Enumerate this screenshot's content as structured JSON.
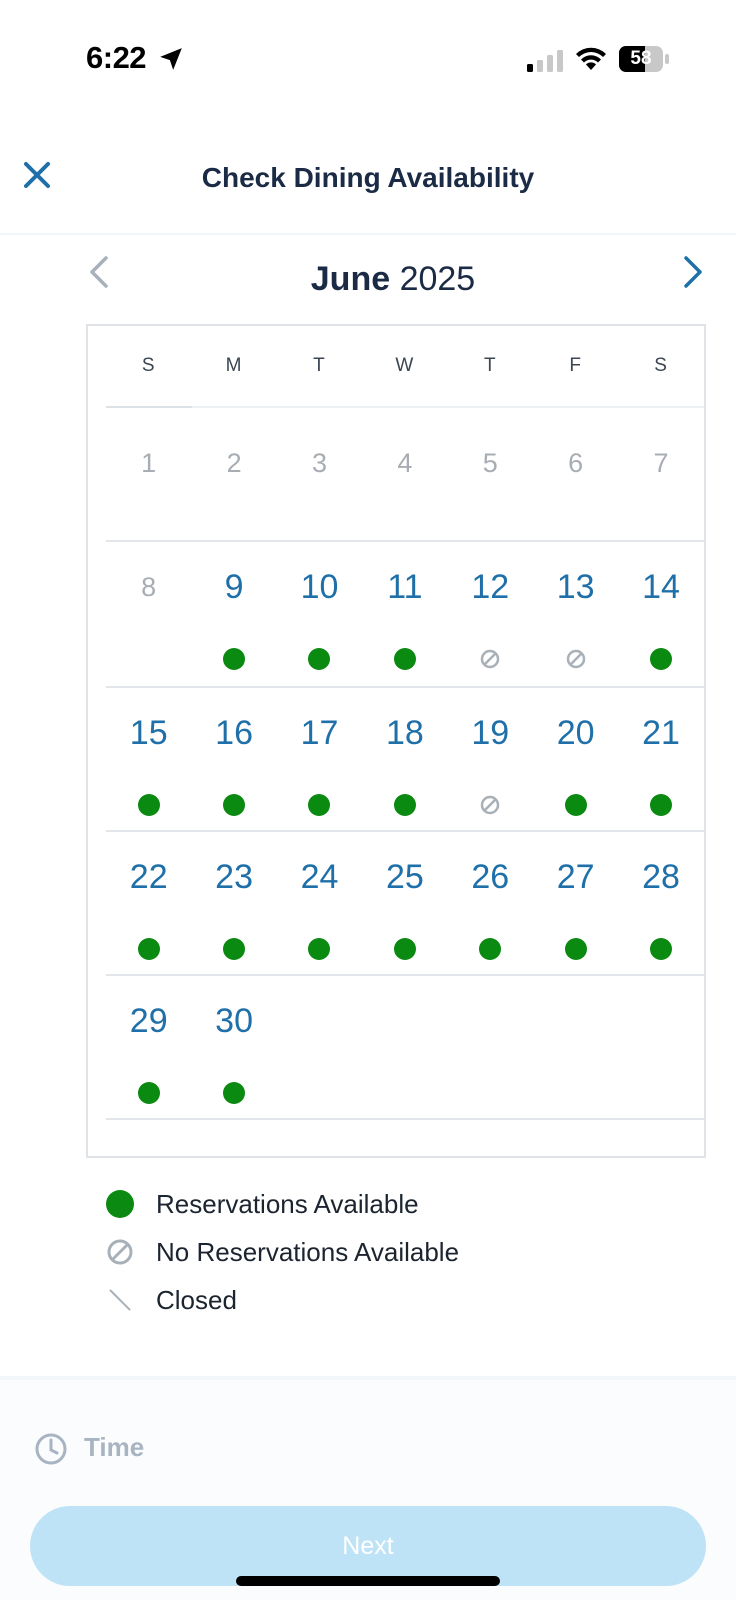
{
  "status_bar": {
    "time": "6:22",
    "battery": "58"
  },
  "header": {
    "title": "Check Dining Availability"
  },
  "calendar": {
    "month": "June",
    "year": "2025",
    "weekdays": [
      "S",
      "M",
      "T",
      "W",
      "T",
      "F",
      "S"
    ],
    "weeks": [
      [
        {
          "day": "1",
          "status": "past"
        },
        {
          "day": "2",
          "status": "past"
        },
        {
          "day": "3",
          "status": "past"
        },
        {
          "day": "4",
          "status": "past"
        },
        {
          "day": "5",
          "status": "past"
        },
        {
          "day": "6",
          "status": "past"
        },
        {
          "day": "7",
          "status": "past"
        }
      ],
      [
        {
          "day": "8",
          "status": "past"
        },
        {
          "day": "9",
          "status": "available"
        },
        {
          "day": "10",
          "status": "available"
        },
        {
          "day": "11",
          "status": "available"
        },
        {
          "day": "12",
          "status": "none"
        },
        {
          "day": "13",
          "status": "none"
        },
        {
          "day": "14",
          "status": "available"
        }
      ],
      [
        {
          "day": "15",
          "status": "available"
        },
        {
          "day": "16",
          "status": "available"
        },
        {
          "day": "17",
          "status": "available"
        },
        {
          "day": "18",
          "status": "available"
        },
        {
          "day": "19",
          "status": "none"
        },
        {
          "day": "20",
          "status": "available"
        },
        {
          "day": "21",
          "status": "available"
        }
      ],
      [
        {
          "day": "22",
          "status": "available"
        },
        {
          "day": "23",
          "status": "available"
        },
        {
          "day": "24",
          "status": "available"
        },
        {
          "day": "25",
          "status": "available"
        },
        {
          "day": "26",
          "status": "available"
        },
        {
          "day": "27",
          "status": "available"
        },
        {
          "day": "28",
          "status": "available"
        }
      ],
      [
        {
          "day": "29",
          "status": "available"
        },
        {
          "day": "30",
          "status": "available"
        }
      ]
    ]
  },
  "legend": {
    "available": "Reservations Available",
    "none": "No Reservations Available",
    "closed": "Closed"
  },
  "time_section": {
    "label": "Time"
  },
  "next_button": {
    "label": "Next"
  },
  "colors": {
    "accent": "#1f6fa8",
    "available_dot": "#0b8a12",
    "disabled_text": "#a8adb4",
    "next_button_bg": "#bfe3f6"
  }
}
